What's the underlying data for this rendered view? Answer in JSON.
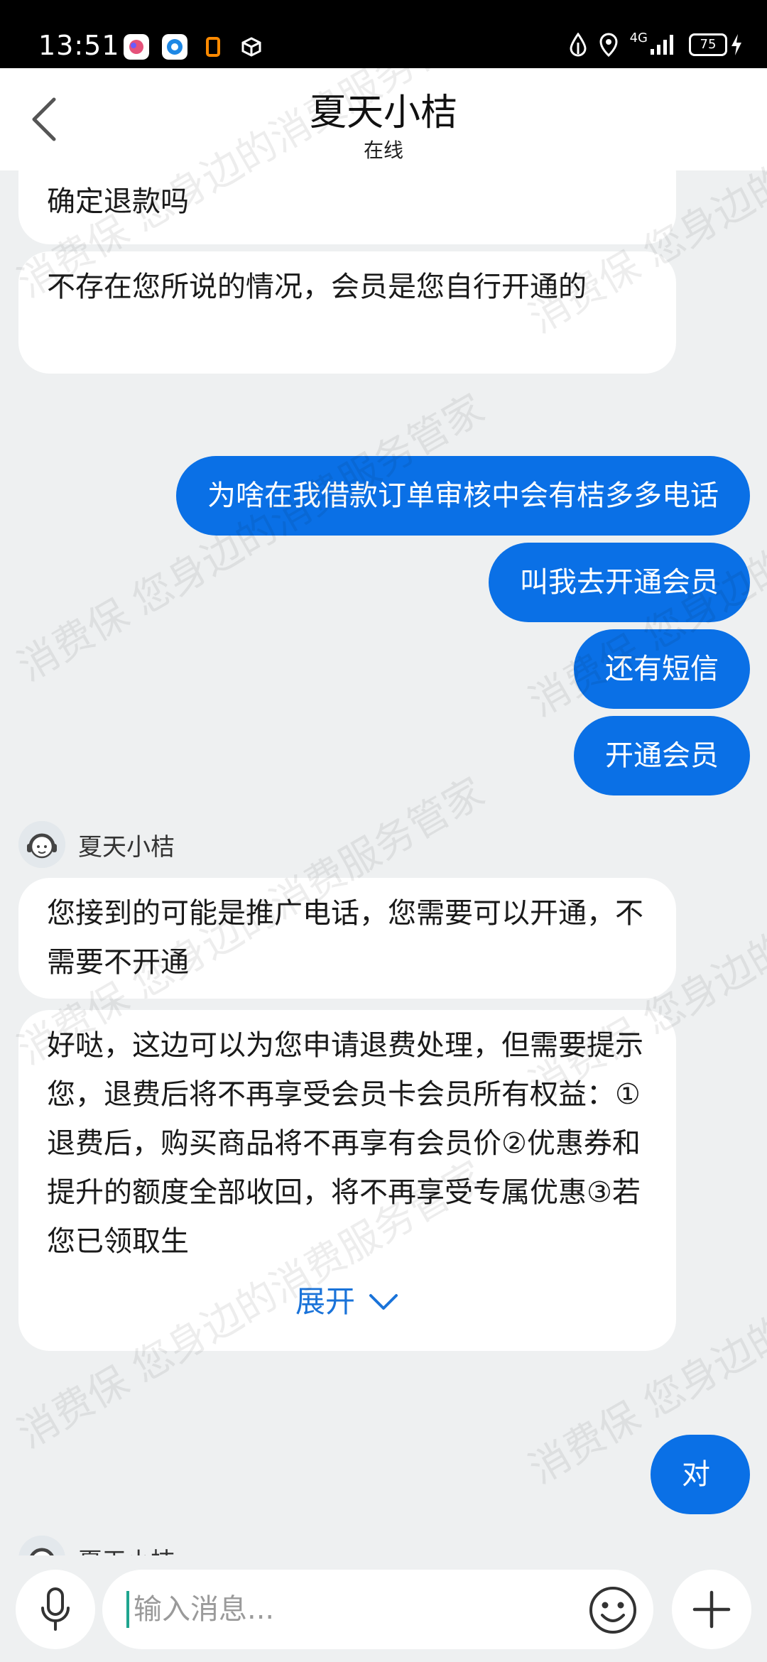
{
  "status_bar": {
    "time": "13:51",
    "network": "4G",
    "battery": "75",
    "notification_icons": [
      "app-icon-1",
      "app-icon-2",
      "app-icon-3",
      "app-icon-4"
    ]
  },
  "header": {
    "title": "夏天小桔",
    "subtitle": "在线"
  },
  "messages": {
    "m1": "确定退款吗",
    "m2": "不存在您所说的情况，会员是您自行开通的",
    "out1": "为啥在我借款订单审核中会有桔多多电话",
    "out2": "叫我去开通会员",
    "out3": "还有短信",
    "out4": "开通会员",
    "agent_name": "夏天小桔",
    "m3": "您接到的可能是推广电话，您需要可以开通，不需要不开通",
    "m4": "好哒，这边可以为您申请退费处理，但需要提示您，退费后将不再享受会员卡会员所有权益：①退费后，购买商品将不再享有会员价②优惠券和提升的额度全部收回，将不再享受专属优惠③若您已领取生",
    "expand_label": "展开",
    "out5": "对",
    "agent_name_2": "夏天小桔"
  },
  "input": {
    "placeholder": "输入消息..."
  },
  "watermark": {
    "text": "消费保 您身边的消费服务管家"
  },
  "colors": {
    "accent_blue": "#0a70e6",
    "link_blue": "#1a73d9",
    "background": "#eef0f1"
  }
}
